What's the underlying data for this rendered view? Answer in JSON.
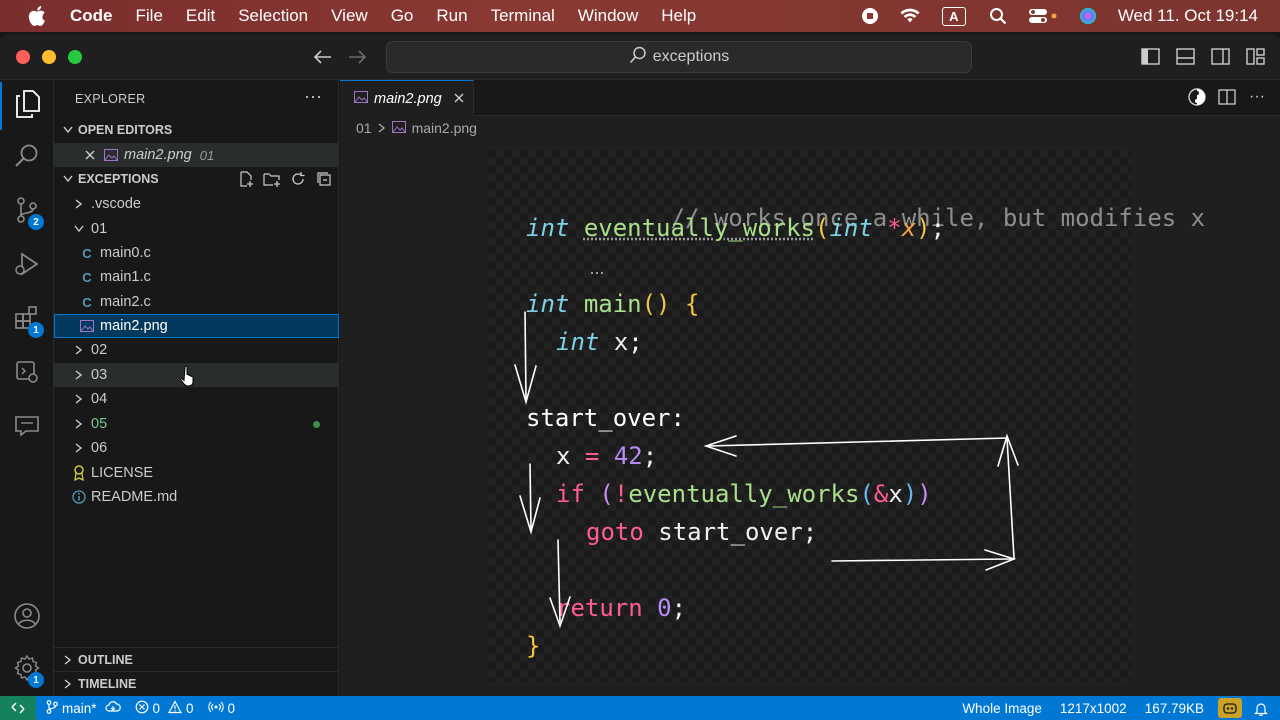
{
  "menubar": {
    "app_name": "Code",
    "items": [
      "File",
      "Edit",
      "Selection",
      "View",
      "Go",
      "Run",
      "Terminal",
      "Window",
      "Help"
    ],
    "clock": "Wed 11. Oct  19:14",
    "input_indicator": "A"
  },
  "titlebar": {
    "search_text": "exceptions"
  },
  "activitybar": {
    "scm_badge": "2",
    "extensions_badge": "1",
    "settings_badge": "1"
  },
  "sidebar": {
    "title": "EXPLORER",
    "more": "···",
    "open_editors_label": "OPEN EDITORS",
    "open_editor": {
      "name": "main2.png",
      "folder": "01"
    },
    "workspace_label": "EXCEPTIONS",
    "tree": [
      {
        "label": ".vscode",
        "kind": "folder",
        "expanded": false
      },
      {
        "label": "01",
        "kind": "folder",
        "expanded": true
      },
      {
        "label": "main0.c",
        "kind": "c-file"
      },
      {
        "label": "main1.c",
        "kind": "c-file"
      },
      {
        "label": "main2.c",
        "kind": "c-file"
      },
      {
        "label": "main2.png",
        "kind": "image",
        "selected": true
      },
      {
        "label": "02",
        "kind": "folder",
        "expanded": false
      },
      {
        "label": "03",
        "kind": "folder",
        "expanded": false,
        "hover": true
      },
      {
        "label": "04",
        "kind": "folder",
        "expanded": false
      },
      {
        "label": "05",
        "kind": "folder",
        "expanded": false,
        "modified": true
      },
      {
        "label": "06",
        "kind": "folder",
        "expanded": false
      },
      {
        "label": "LICENSE",
        "kind": "license"
      },
      {
        "label": "README.md",
        "kind": "readme"
      }
    ],
    "outline_label": "OUTLINE",
    "timeline_label": "TIMELINE"
  },
  "editor": {
    "tab_label": "main2.png",
    "breadcrumb": [
      "01",
      "main2.png"
    ],
    "code": {
      "comment": "// works once a while, but modifies x",
      "decl_type": "int",
      "decl_fn": "eventually_works",
      "decl_param_type": "int",
      "decl_star": "*",
      "decl_param": "x",
      "main_type": "int",
      "main_name": "main",
      "local_type": "int",
      "local_var": "x;",
      "label": "start_over:",
      "assign_var": "x",
      "assign_op": "=",
      "assign_val": "42",
      "if_kw": "if",
      "if_not": "!",
      "if_fn": "eventually_works",
      "if_amp": "&",
      "if_arg": "x",
      "goto_kw": "goto",
      "goto_target": "start_over;",
      "return_kw": "return",
      "return_val": "0"
    }
  },
  "statusbar": {
    "branch": "main*",
    "errors": "0",
    "warnings": "0",
    "ports": "0",
    "view_mode": "Whole Image",
    "dimensions": "1217x1002",
    "size": "167.79KB"
  }
}
